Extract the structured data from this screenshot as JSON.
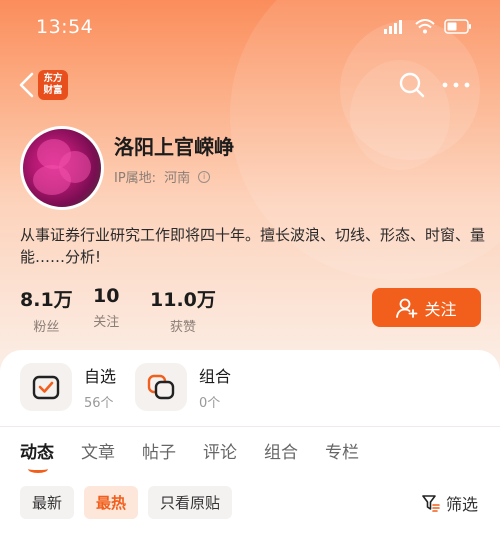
{
  "status_bar": {
    "time": "13:54"
  },
  "brand": {
    "logo_line1": "东方",
    "logo_line2": "财富",
    "logo_color": "#e84f1c"
  },
  "profile": {
    "name": "洛阳上官嵘峥",
    "ip_label": "IP属地:",
    "ip_value": "河南",
    "bio": "从事证券行业研究工作即将四十年。擅长波浪、切线、形态、时窗、量能……分析!"
  },
  "stats": [
    {
      "value": "8.1万",
      "label": "粉丝"
    },
    {
      "value": "10",
      "label": "关注"
    },
    {
      "value": "11.0万",
      "label": "获赞"
    }
  ],
  "follow_button": {
    "label": "关注",
    "color": "#f25f1c"
  },
  "shortcuts": [
    {
      "title": "自选",
      "count": "56个",
      "icon": "watchlist-check-icon"
    },
    {
      "title": "组合",
      "count": "0个",
      "icon": "portfolio-icon"
    }
  ],
  "tabs": [
    "动态",
    "文章",
    "帖子",
    "评论",
    "组合",
    "专栏"
  ],
  "active_tab": "动态",
  "filters": [
    {
      "label": "最新",
      "active": false
    },
    {
      "label": "最热",
      "active": true
    },
    {
      "label": "只看原贴",
      "active": false
    }
  ],
  "filter_button": {
    "label": "筛选"
  },
  "colors": {
    "accent": "#f25f1c",
    "header_top": "#fb8d5b"
  }
}
